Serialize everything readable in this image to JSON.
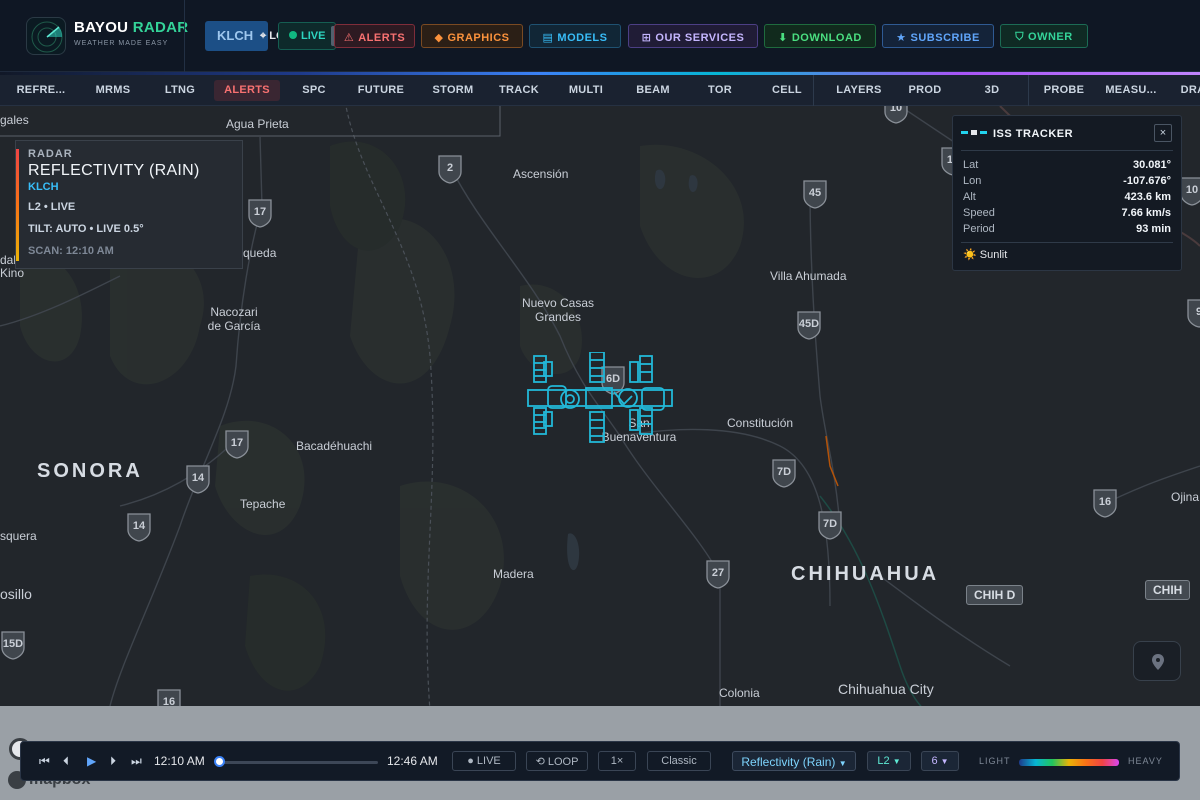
{
  "header": {
    "brand_primary": "BAYOU",
    "brand_accent": "RADAR",
    "tagline": "WEATHER MADE EASY",
    "station_button": "KLCH",
    "locate_label": "LOCATE",
    "live_label": "LIVE",
    "nav": [
      {
        "label": "ALERTS",
        "icon": "warning-icon",
        "glyph": "⚠",
        "color": "#f87171",
        "bg": "#2d1a22",
        "border": "#7f2d3a"
      },
      {
        "label": "GRAPHICS",
        "icon": "diamond-icon",
        "glyph": "◆",
        "color": "#fb923c",
        "bg": "#2b1f16",
        "border": "#7a4a22"
      },
      {
        "label": "MODELS",
        "icon": "layers-icon",
        "glyph": "▤",
        "color": "#38bdf8",
        "bg": "#112636",
        "border": "#1f5272"
      },
      {
        "label": "OUR SERVICES",
        "icon": "grid-icon",
        "glyph": "⊞",
        "color": "#c4b5fd",
        "bg": "#201c36",
        "border": "#4c3f85"
      },
      {
        "label": "DOWNLOAD",
        "icon": "download-icon",
        "glyph": "⬇",
        "color": "#4ade80",
        "bg": "#112a1d",
        "border": "#1f6b3e"
      },
      {
        "label": "SUBSCRIBE",
        "icon": "star-icon",
        "glyph": "★",
        "color": "#60a5fa",
        "bg": "#142339",
        "border": "#2f5a93"
      },
      {
        "label": "OWNER",
        "icon": "shield-icon",
        "glyph": "⛉",
        "color": "#34d399",
        "bg": "#0f2a24",
        "border": "#1c6b55"
      }
    ]
  },
  "toolbar": {
    "items": [
      "REFRE...",
      "MRMS",
      "LTNG",
      "ALERTS",
      "SPC",
      "FUTURE",
      "STORM",
      "TRACK",
      "MULTI",
      "BEAM",
      "TOR",
      "CELL",
      "LAYERS",
      "PROD",
      "3D",
      "PROBE",
      "MEASU...",
      "DRAW"
    ],
    "active": "ALERTS"
  },
  "radar_panel": {
    "label": "RADAR",
    "product": "REFLECTIVITY (RAIN)",
    "station": "KLCH",
    "level_line": "L2 • LIVE",
    "tilt_line": "TILT: AUTO • LIVE 0.5°",
    "scan_line": "SCAN: 12:10 AM"
  },
  "iss": {
    "title": "ISS TRACKER",
    "close": "×",
    "rows": [
      {
        "k": "Lat",
        "v": "30.081°"
      },
      {
        "k": "Lon",
        "v": "-107.676°"
      },
      {
        "k": "Alt",
        "v": "423.6 km"
      },
      {
        "k": "Speed",
        "v": "7.66 km/s"
      },
      {
        "k": "Period",
        "v": "93 min"
      }
    ],
    "status": "☀️ Sunlit"
  },
  "map": {
    "places": [
      "gales",
      "Agua Prieta",
      "Ascensión",
      "dal",
      "Kino",
      "queda",
      "Nacozari de García",
      "Nuevo Casas Grandes",
      "Villa Ahumada",
      "Constitución",
      "San Buenaventura",
      "Bacadéhuachi",
      "Tepache",
      "squera",
      "osillo",
      "Madera",
      "Ojina",
      "Colonia",
      "Chihuahua City"
    ],
    "states": [
      "SONORA",
      "CHIHUAHUA"
    ],
    "shields": [
      "2",
      "17",
      "45",
      "45D",
      "6D",
      "17",
      "14",
      "14",
      "7D",
      "7D",
      "16",
      "27",
      "15D",
      "10",
      "16",
      "9",
      "10",
      "16"
    ],
    "road_signs": [
      "CHIH D",
      "CHIH"
    ]
  },
  "playback": {
    "start_time": "12:10 AM",
    "end_time": "12:46 AM",
    "progress": 0.0,
    "live": "LIVE",
    "loop": "LOOP",
    "speed": "1×",
    "style": "Classic",
    "product": "Reflectivity (Rain)",
    "level": "L2",
    "count": "6",
    "scale_low": "LIGHT",
    "scale_high": "HEAVY"
  },
  "attribution": "mapbox"
}
